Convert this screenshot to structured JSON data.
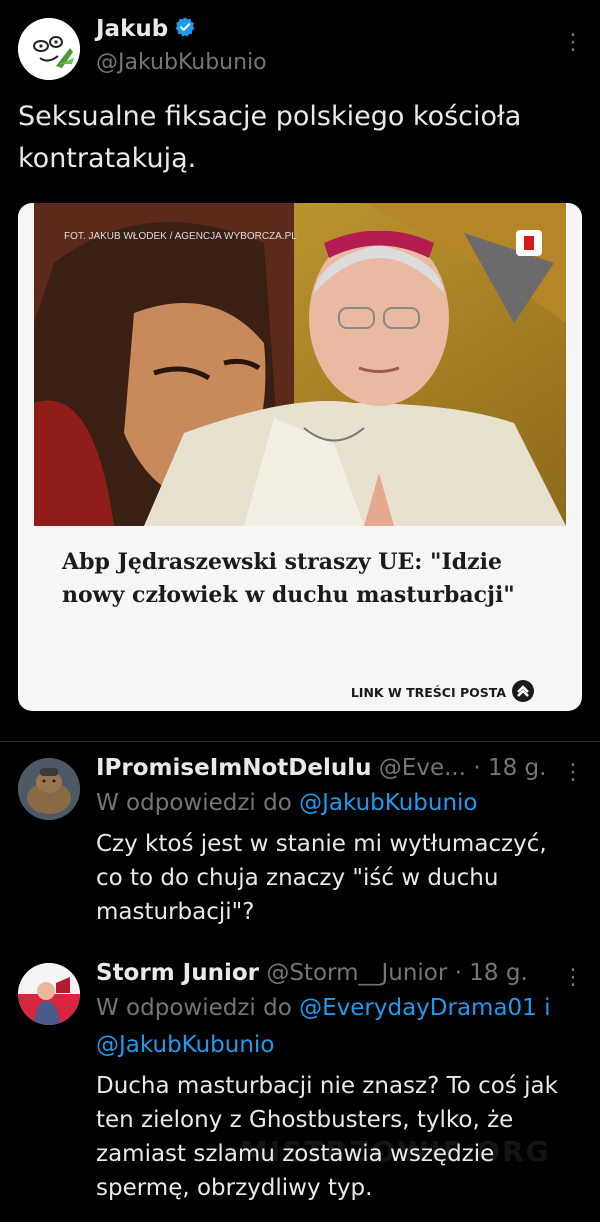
{
  "tweet": {
    "author_name": "Jakub",
    "author_handle": "@JakubKubunio",
    "text": "Seksualne fiksacje polskiego kościoła kontratakują.",
    "card": {
      "photo_credit": "FOT. JAKUB WŁODEK / AGENCJA WYBORCZA.PL",
      "headline": "Abp Jędraszewski straszy UE: \"Idzie nowy człowiek w duchu masturbacji\"",
      "footer": "LINK W TREŚCI POSTA"
    }
  },
  "replies": [
    {
      "name": "IPromiseImNotDelulu",
      "handle": "@Eve...",
      "time": "· 18 g.",
      "reply_prefix": "W odpowiedzi do",
      "reply_to": "@JakubKubunio",
      "text": "Czy ktoś jest w stanie mi wytłumaczyć, co to do chuja znaczy \"iść w duchu masturbacji\"?"
    },
    {
      "name": "Storm Junior",
      "handle": "@Storm__Junior",
      "time": "· 18 g.",
      "reply_prefix": "W odpowiedzi do",
      "reply_to": "@EverydayDrama01 i",
      "reply_to_2": "@JakubKubunio",
      "text": "Ducha masturbacji nie znasz? To coś jak ten zielony z Ghostbusters, tylko, że zamiast szlamu zostawia wszędzie spermę, obrzydliwy typ."
    }
  ],
  "watermark": "MISTRZOWIE.ORG",
  "icons": {
    "verified": "verified-badge-icon",
    "more": "more-vertical-icon",
    "chevron": "chevron-up-icon"
  },
  "colors": {
    "background": "#000000",
    "link": "#1d9bf0",
    "secondary": "#71767b",
    "text": "#e7e9ea"
  }
}
